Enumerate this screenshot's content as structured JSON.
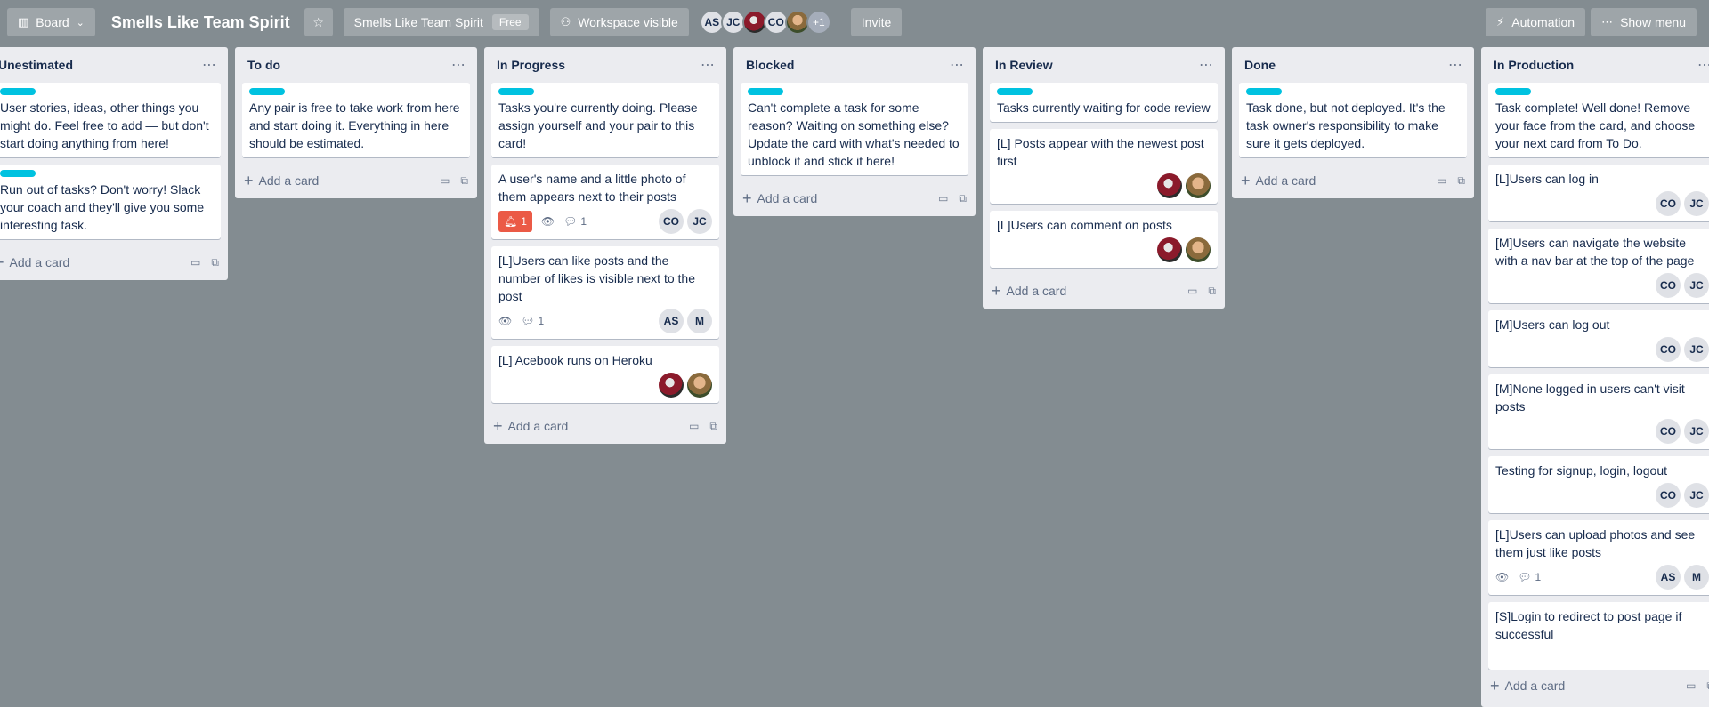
{
  "header": {
    "view_label": "Board",
    "board_title": "Smells Like Team Spirit",
    "workspace_name": "Smells Like Team Spirit",
    "workspace_plan": "Free",
    "visibility": "Workspace visible",
    "members": [
      "AS",
      "JC",
      "",
      "CO",
      ""
    ],
    "members_more": "+1",
    "invite_label": "Invite",
    "automation_label": "Automation",
    "show_menu_label": "Show menu"
  },
  "add_card_label": "Add a card",
  "lists": [
    {
      "title": "Unestimated",
      "cards": [
        {
          "text": "User stories, ideas, other things you might do. Feel free to add — but don't start doing anything from here!"
        },
        {
          "text": "Run out of tasks? Don't worry! Slack your coach and they'll give you some interesting task."
        }
      ]
    },
    {
      "title": "To do",
      "cards": [
        {
          "text": "Any pair is free to take work from here and start doing it. Everything in here should be estimated."
        }
      ]
    },
    {
      "title": "In Progress",
      "cards": [
        {
          "text": "Tasks you're currently doing. Please assign yourself and your pair to this card!"
        },
        {
          "text": "A user's name and a little photo of them appears next to their posts",
          "alert_count": "1",
          "comments": "1",
          "avatars": [
            "CO",
            "JC"
          ]
        },
        {
          "text": "[L]Users can like posts and the number of likes is visible next to the post",
          "comments": "1",
          "avatars": [
            "AS",
            "M"
          ]
        },
        {
          "text": "[L] Acebook runs on Heroku"
        }
      ]
    },
    {
      "title": "Blocked",
      "cards": [
        {
          "text": "Can't complete a task for some reason? Waiting on something else? Update the card with what's needed to unblock it and stick it here!"
        }
      ]
    },
    {
      "title": "In Review",
      "cards": [
        {
          "text": "Tasks currently waiting for code review"
        },
        {
          "text": "[L] Posts appear with the newest post first"
        },
        {
          "text": "[L]Users can comment on posts"
        }
      ]
    },
    {
      "title": "Done",
      "cards": [
        {
          "text": "Task done, but not deployed. It's the task owner's responsibility to make sure it gets deployed."
        }
      ]
    },
    {
      "title": "In Production",
      "cards": [
        {
          "text": "Task complete! Well done! Remove your face from the card, and choose your next card from To Do."
        },
        {
          "text": "[L]Users can log in",
          "avatars": [
            "CO",
            "JC"
          ]
        },
        {
          "text": "[M]Users can navigate the website with a nav bar at the top of the page",
          "avatars": [
            "CO",
            "JC"
          ]
        },
        {
          "text": "[M]Users can log out",
          "avatars": [
            "CO",
            "JC"
          ]
        },
        {
          "text": "[M]None logged in users can't visit posts",
          "avatars": [
            "CO",
            "JC"
          ]
        },
        {
          "text": "Testing for signup, login, logout",
          "avatars": [
            "CO",
            "JC"
          ]
        },
        {
          "text": "[L]Users can upload photos and see them just like posts",
          "comments": "1",
          "avatars": [
            "AS",
            "M"
          ]
        },
        {
          "text": "[S]Login to redirect to post page if successful"
        }
      ]
    }
  ],
  "colors": {
    "background": "#838c91",
    "label": "#00c2e0",
    "alert": "#eb5a46"
  }
}
